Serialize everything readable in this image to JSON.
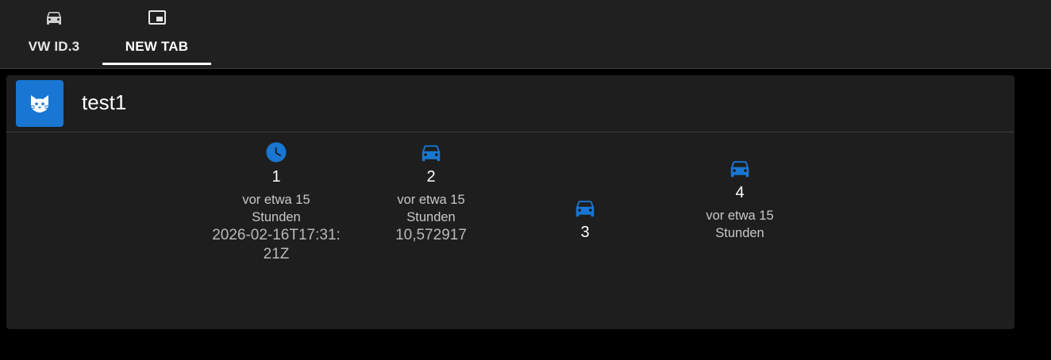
{
  "tabs": [
    {
      "label": "VW ID.3",
      "icon": "car-icon",
      "active": false
    },
    {
      "label": "NEW TAB",
      "icon": "picture-in-picture-icon",
      "active": true
    }
  ],
  "card": {
    "title": "test1",
    "avatar_icon": "cat-icon",
    "accent": "#1976d2",
    "entities": [
      {
        "name": "1",
        "icon": "clock-icon",
        "relative": "vor etwa 15 Stunden",
        "value": "2026-02-16T17:31:21Z"
      },
      {
        "name": "2",
        "icon": "car-icon",
        "relative": "vor etwa 15 Stunden",
        "value": "10,572917"
      },
      {
        "name": "3",
        "icon": "car-icon"
      },
      {
        "name": "4",
        "icon": "car-icon",
        "relative": "vor etwa 15 Stunden"
      }
    ]
  }
}
